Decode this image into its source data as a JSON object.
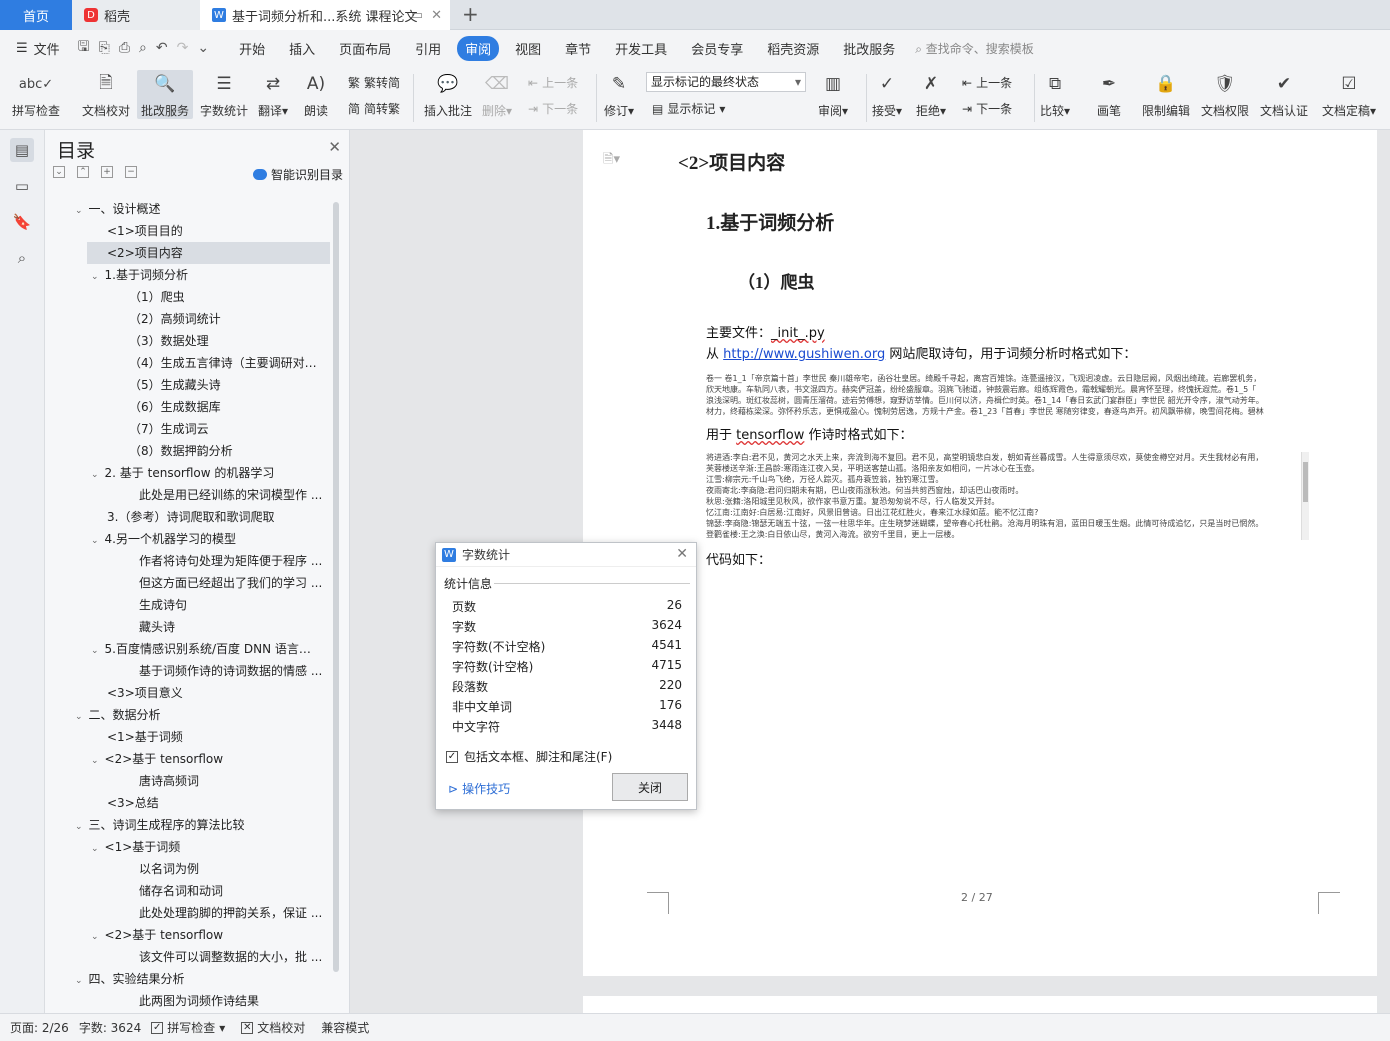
{
  "tabs": {
    "home": "首页",
    "daoke": "稻壳",
    "doc": "基于词频分析和...系统 课程论文"
  },
  "menu": {
    "file": "文件",
    "items": [
      "开始",
      "插入",
      "页面布局",
      "引用",
      "审阅",
      "视图",
      "章节",
      "开发工具",
      "会员专享",
      "稻壳资源",
      "批改服务"
    ],
    "active": "审阅",
    "search": "查找命令、搜索模板"
  },
  "ribbon": {
    "spell": "拼写检查",
    "proof": "文档校对",
    "correct": "批改服务",
    "wordcount": "字数统计",
    "translate": "翻译",
    "read": "朗读",
    "to_trad": "繁转简",
    "to_simp": "简转繁",
    "insert_comment": "插入批注",
    "delete": "删除",
    "prev": "上一条",
    "next": "下一条",
    "revise": "修订",
    "markup_select": "显示标记的最终状态",
    "show_markup": "显示标记",
    "review": "审阅",
    "accept": "接受",
    "reject": "拒绝",
    "prev2": "上一条",
    "next2": "下一条",
    "compare": "比较",
    "pen": "画笔",
    "restrict": "限制编辑",
    "permission": "文档权限",
    "certify": "文档认证",
    "finalize": "文档定稿"
  },
  "toc": {
    "title": "目录",
    "smart": "智能识别目录",
    "items": [
      {
        "text": "一、设计概述",
        "level": 0,
        "caret": true
      },
      {
        "text": "<1>项目目的",
        "level": 1,
        "caret": false
      },
      {
        "text": "<2>项目内容",
        "level": 1,
        "caret": false,
        "selected": true
      },
      {
        "text": "1.基于词频分析",
        "level": 1,
        "caret": true
      },
      {
        "text": "（1）爬虫",
        "level": 2,
        "caret": false
      },
      {
        "text": "（2）高频词统计",
        "level": 2,
        "caret": false
      },
      {
        "text": "（3）数据处理",
        "level": 2,
        "caret": false
      },
      {
        "text": "（4）生成五言律诗（主要调研对象 ...",
        "level": 2,
        "caret": false
      },
      {
        "text": "（5）生成藏头诗",
        "level": 2,
        "caret": false
      },
      {
        "text": "（6）生成数据库",
        "level": 2,
        "caret": false
      },
      {
        "text": "（7）生成词云",
        "level": 2,
        "caret": false
      },
      {
        "text": "（8）数据押韵分析",
        "level": 2,
        "caret": false
      },
      {
        "text": "2. 基于 tensorflow 的机器学习",
        "level": 1,
        "caret": true
      },
      {
        "text": "此处是用已经训练的宋词模型作 ...",
        "level": 3,
        "caret": false
      },
      {
        "text": "3.（参考）诗词爬取和歌词爬取",
        "level": 1,
        "caret": false
      },
      {
        "text": "4.另一个机器学习的模型",
        "level": 1,
        "caret": true
      },
      {
        "text": "作者将诗句处理为矩阵便于程序 ...",
        "level": 3,
        "caret": false
      },
      {
        "text": "但这方面已经超出了我们的学习 ...",
        "level": 3,
        "caret": false
      },
      {
        "text": "生成诗句",
        "level": 3,
        "caret": false
      },
      {
        "text": "藏头诗",
        "level": 3,
        "caret": false
      },
      {
        "text": "5.百度情感识别系统/百度 DNN 语言 ...",
        "level": 1,
        "caret": true
      },
      {
        "text": "基于词频作诗的诗词数据的情感 ...",
        "level": 3,
        "caret": false
      },
      {
        "text": "<3>项目意义",
        "level": 1,
        "caret": false
      },
      {
        "text": "二、数据分析",
        "level": 0,
        "caret": true
      },
      {
        "text": "<1>基于词频",
        "level": 1,
        "caret": false
      },
      {
        "text": "<2>基于 tensorflow",
        "level": 1,
        "caret": true
      },
      {
        "text": "唐诗高频词",
        "level": 3,
        "caret": false
      },
      {
        "text": "<3>总结",
        "level": 1,
        "caret": false
      },
      {
        "text": "三、诗词生成程序的算法比较",
        "level": 0,
        "caret": true
      },
      {
        "text": "<1>基于词频",
        "level": 1,
        "caret": true
      },
      {
        "text": "以名词为例",
        "level": 3,
        "caret": false
      },
      {
        "text": "储存名词和动词",
        "level": 3,
        "caret": false
      },
      {
        "text": "此处处理韵脚的押韵关系，保证 ...",
        "level": 3,
        "caret": false
      },
      {
        "text": "<2>基于 tensorflow",
        "level": 1,
        "caret": true
      },
      {
        "text": "该文件可以调整数据的大小，批 ...",
        "level": 3,
        "caret": false
      },
      {
        "text": "四、实验结果分析",
        "level": 0,
        "caret": true
      },
      {
        "text": "此两图为词频作诗结果",
        "level": 3,
        "caret": false
      }
    ]
  },
  "document": {
    "h2": "<2>项目内容",
    "h3": "1.基于词频分析",
    "h4": "（1）爬虫",
    "main_file_label": "主要文件：",
    "main_file": "_init_.py",
    "from": "从",
    "url": "http://www.gushiwen.org",
    "from_rest": "网站爬取诗句，用于词频分析时格式如下：",
    "block1": [
      "卷一 卷1_1「帝京篇十首」李世民 秦川雄帝宅，函谷壮皇居。绮殿千寻起，离宫百雉馀。连甍遥接汉，飞观迥凌虚。云日隐层阙，风烟出绮疏。岩廊罢机务，",
      "欣天地康。车轨同八表，书文混四方。赫奕俨冠盖，纷纶盛服章。羽旄飞驰道，钟鼓震岩廊。组练辉霞色，霜戟耀朝光。晨宵怀至理，终愧抚遐荒。卷1_5「",
      "浪浅深明。斑红妆蕊树，圆青压溜荷。迹岩劳傅想，窥野访莘情。巨川何以济，舟楫伫时英。卷1_14「春日玄武门宴群臣」李世民 韶光开令序，淑气动芳年。",
      "材力，终藉栋梁深。弥怀矜乐志，更惧戒盈心。愧制劳居逸，方规十产金。卷1_23「首春」李世民 寒随穷律变，春逐鸟声开。初风飘带柳，晚雪间花梅。碧林"
    ],
    "tf_label_pre": "用于",
    "tf_word": "tensorflow",
    "tf_label_post": "作诗时格式如下：",
    "block2": [
      "将进酒:李白:君不见，黄河之水天上来，奔流到海不复回。君不见，高堂明镜悲白发，朝如青丝暮成雪。人生得意须尽欢，莫使金樽空对月。天生我材必有用，",
      "芙蓉楼送辛渐:王昌龄:寒雨连江夜入吴，平明送客楚山孤。洛阳亲友如相问，一片冰心在玉壶。",
      "江雪:柳宗元:千山鸟飞绝，万径人踪灭。孤舟蓑笠翁，独钓寒江雪。",
      "夜雨寄北:李商隐:君问归期未有期，巴山夜雨涨秋池。何当共剪西窗烛，却话巴山夜雨时。",
      "秋思:张籍:洛阳城里见秋风，欲作家书意万重。复恐匆匆说不尽，行人临发又开封。",
      "忆江南:江南好:白居易:江南好，风景旧曾谙。日出江花红胜火，春来江水绿如蓝。能不忆江南?",
      "锦瑟:李商隐:锦瑟无端五十弦，一弦一柱思华年。庄生晓梦迷蝴蝶，望帝春心托杜鹃。沧海月明珠有泪，蓝田日暖玉生烟。此情可待成追忆，只是当时已惘然。",
      "登鹳雀楼:王之涣:白日依山尽，黄河入海流。欲穷千里目，更上一层楼。"
    ],
    "code_label": "代码如下：",
    "page_num": "2 / 27"
  },
  "dialog": {
    "title": "字数统计",
    "section": "统计信息",
    "rows": [
      {
        "label": "页数",
        "value": "26"
      },
      {
        "label": "字数",
        "value": "3624"
      },
      {
        "label": "字符数(不计空格)",
        "value": "4541"
      },
      {
        "label": "字符数(计空格)",
        "value": "4715"
      },
      {
        "label": "段落数",
        "value": "220"
      },
      {
        "label": "非中文单词",
        "value": "176"
      },
      {
        "label": "中文字符",
        "value": "3448"
      }
    ],
    "checkbox": "包括文本框、脚注和尾注(F)",
    "tips": "操作技巧",
    "close": "关闭"
  },
  "status": {
    "page": "页面: 2/26",
    "words": "字数: 3624",
    "spell": "拼写检查",
    "proof": "文档校对",
    "compat": "兼容模式"
  }
}
